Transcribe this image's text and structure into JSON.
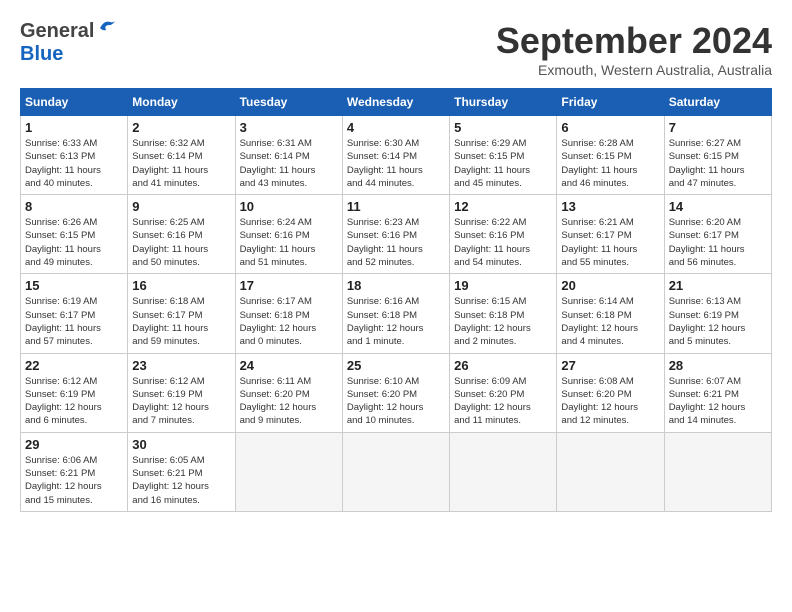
{
  "header": {
    "logo_general": "General",
    "logo_blue": "Blue",
    "month_title": "September 2024",
    "subtitle": "Exmouth, Western Australia, Australia"
  },
  "calendar": {
    "days_of_week": [
      "Sunday",
      "Monday",
      "Tuesday",
      "Wednesday",
      "Thursday",
      "Friday",
      "Saturday"
    ],
    "weeks": [
      [
        {
          "day": "",
          "info": ""
        },
        {
          "day": "2",
          "info": "Sunrise: 6:32 AM\nSunset: 6:14 PM\nDaylight: 11 hours\nand 41 minutes."
        },
        {
          "day": "3",
          "info": "Sunrise: 6:31 AM\nSunset: 6:14 PM\nDaylight: 11 hours\nand 43 minutes."
        },
        {
          "day": "4",
          "info": "Sunrise: 6:30 AM\nSunset: 6:14 PM\nDaylight: 11 hours\nand 44 minutes."
        },
        {
          "day": "5",
          "info": "Sunrise: 6:29 AM\nSunset: 6:15 PM\nDaylight: 11 hours\nand 45 minutes."
        },
        {
          "day": "6",
          "info": "Sunrise: 6:28 AM\nSunset: 6:15 PM\nDaylight: 11 hours\nand 46 minutes."
        },
        {
          "day": "7",
          "info": "Sunrise: 6:27 AM\nSunset: 6:15 PM\nDaylight: 11 hours\nand 47 minutes."
        }
      ],
      [
        {
          "day": "1",
          "info": "Sunrise: 6:33 AM\nSunset: 6:13 PM\nDaylight: 11 hours\nand 40 minutes."
        },
        {
          "day": "",
          "info": ""
        },
        {
          "day": "",
          "info": ""
        },
        {
          "day": "",
          "info": ""
        },
        {
          "day": "",
          "info": ""
        },
        {
          "day": "",
          "info": ""
        },
        {
          "day": "",
          "info": ""
        }
      ],
      [
        {
          "day": "8",
          "info": "Sunrise: 6:26 AM\nSunset: 6:15 PM\nDaylight: 11 hours\nand 49 minutes."
        },
        {
          "day": "9",
          "info": "Sunrise: 6:25 AM\nSunset: 6:16 PM\nDaylight: 11 hours\nand 50 minutes."
        },
        {
          "day": "10",
          "info": "Sunrise: 6:24 AM\nSunset: 6:16 PM\nDaylight: 11 hours\nand 51 minutes."
        },
        {
          "day": "11",
          "info": "Sunrise: 6:23 AM\nSunset: 6:16 PM\nDaylight: 11 hours\nand 52 minutes."
        },
        {
          "day": "12",
          "info": "Sunrise: 6:22 AM\nSunset: 6:16 PM\nDaylight: 11 hours\nand 54 minutes."
        },
        {
          "day": "13",
          "info": "Sunrise: 6:21 AM\nSunset: 6:17 PM\nDaylight: 11 hours\nand 55 minutes."
        },
        {
          "day": "14",
          "info": "Sunrise: 6:20 AM\nSunset: 6:17 PM\nDaylight: 11 hours\nand 56 minutes."
        }
      ],
      [
        {
          "day": "15",
          "info": "Sunrise: 6:19 AM\nSunset: 6:17 PM\nDaylight: 11 hours\nand 57 minutes."
        },
        {
          "day": "16",
          "info": "Sunrise: 6:18 AM\nSunset: 6:17 PM\nDaylight: 11 hours\nand 59 minutes."
        },
        {
          "day": "17",
          "info": "Sunrise: 6:17 AM\nSunset: 6:18 PM\nDaylight: 12 hours\nand 0 minutes."
        },
        {
          "day": "18",
          "info": "Sunrise: 6:16 AM\nSunset: 6:18 PM\nDaylight: 12 hours\nand 1 minute."
        },
        {
          "day": "19",
          "info": "Sunrise: 6:15 AM\nSunset: 6:18 PM\nDaylight: 12 hours\nand 2 minutes."
        },
        {
          "day": "20",
          "info": "Sunrise: 6:14 AM\nSunset: 6:18 PM\nDaylight: 12 hours\nand 4 minutes."
        },
        {
          "day": "21",
          "info": "Sunrise: 6:13 AM\nSunset: 6:19 PM\nDaylight: 12 hours\nand 5 minutes."
        }
      ],
      [
        {
          "day": "22",
          "info": "Sunrise: 6:12 AM\nSunset: 6:19 PM\nDaylight: 12 hours\nand 6 minutes."
        },
        {
          "day": "23",
          "info": "Sunrise: 6:12 AM\nSunset: 6:19 PM\nDaylight: 12 hours\nand 7 minutes."
        },
        {
          "day": "24",
          "info": "Sunrise: 6:11 AM\nSunset: 6:20 PM\nDaylight: 12 hours\nand 9 minutes."
        },
        {
          "day": "25",
          "info": "Sunrise: 6:10 AM\nSunset: 6:20 PM\nDaylight: 12 hours\nand 10 minutes."
        },
        {
          "day": "26",
          "info": "Sunrise: 6:09 AM\nSunset: 6:20 PM\nDaylight: 12 hours\nand 11 minutes."
        },
        {
          "day": "27",
          "info": "Sunrise: 6:08 AM\nSunset: 6:20 PM\nDaylight: 12 hours\nand 12 minutes."
        },
        {
          "day": "28",
          "info": "Sunrise: 6:07 AM\nSunset: 6:21 PM\nDaylight: 12 hours\nand 14 minutes."
        }
      ],
      [
        {
          "day": "29",
          "info": "Sunrise: 6:06 AM\nSunset: 6:21 PM\nDaylight: 12 hours\nand 15 minutes."
        },
        {
          "day": "30",
          "info": "Sunrise: 6:05 AM\nSunset: 6:21 PM\nDaylight: 12 hours\nand 16 minutes."
        },
        {
          "day": "",
          "info": ""
        },
        {
          "day": "",
          "info": ""
        },
        {
          "day": "",
          "info": ""
        },
        {
          "day": "",
          "info": ""
        },
        {
          "day": "",
          "info": ""
        }
      ]
    ]
  }
}
